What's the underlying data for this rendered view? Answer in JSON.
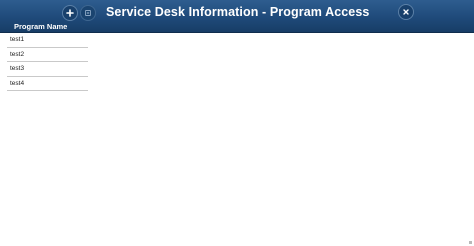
{
  "header": {
    "title": "Service Desk Information - Program Access",
    "column_header": "Program Name",
    "background_color": "#1f4a7a",
    "buttons": {
      "add_icon": "plus-icon",
      "edit_icon": "edit-icon",
      "close_icon": "close-icon"
    }
  },
  "programs": {
    "items": [
      {
        "label": "test1"
      },
      {
        "label": "test2"
      },
      {
        "label": "test3"
      },
      {
        "label": "test4"
      }
    ]
  }
}
